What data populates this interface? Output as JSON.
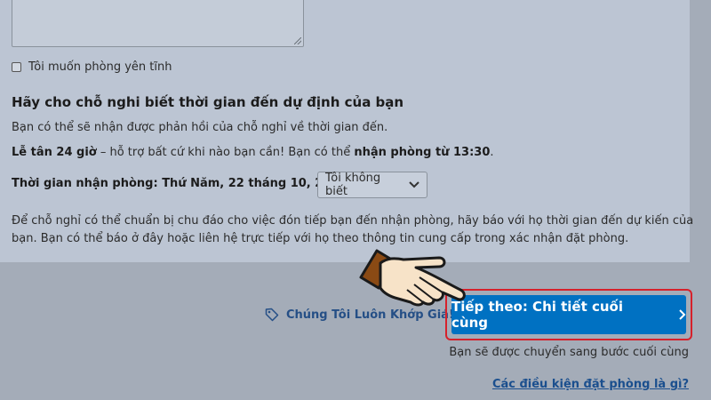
{
  "form": {
    "quiet_room_label": "Tôi muốn phòng yên tĩnh",
    "arrival_heading": "Hãy cho chỗ nghi biết thời gian đến dự định của bạn",
    "arrival_feedback_text": "Bạn có thể sẽ nhận được phản hồi của chỗ nghỉ về thời gian đến.",
    "reception_strong": "Lễ tân 24 giờ",
    "reception_text": " – hỗ trợ bất cứ khi nào bạn cần! Bạn có thể ",
    "checkin_strong": "nhận phòng từ 13:30",
    "checkin_period": ".",
    "checkin_time_label": "Thời gian nhận phòng: Thứ Năm, 22 tháng 10, 2020",
    "checkin_select_value": "Tôi không biết",
    "note_line1": "Để chỗ nghỉ có thể chuẩn bị chu đáo cho việc đón tiếp bạn đến nhận phòng, hãy báo với họ thời gian đến dự kiến của",
    "note_line2": "bạn. Bạn có thể báo ở đây hoặc liên hệ trực tiếp với họ theo thông tin cung cấp trong xác nhận đặt phòng."
  },
  "footer": {
    "promo_label": "Chúng Tôi Luôn Khớp Giá!",
    "next_button_label": "Tiếp theo: Chi tiết cuối cùng",
    "next_subtext": "Bạn sẽ được chuyển sang bước cuối cùng",
    "conditions_link": "Các điều kiện đặt phòng là gì?"
  },
  "icons": {
    "select_caret": "chevron-down-icon",
    "promo": "price-tag-icon",
    "next": "chevron-right-icon",
    "pointer": "pointing-hand-icon"
  },
  "colors": {
    "primary_button": "#0071c2",
    "highlight_border": "#d6212b",
    "link": "#1b4f8e"
  }
}
